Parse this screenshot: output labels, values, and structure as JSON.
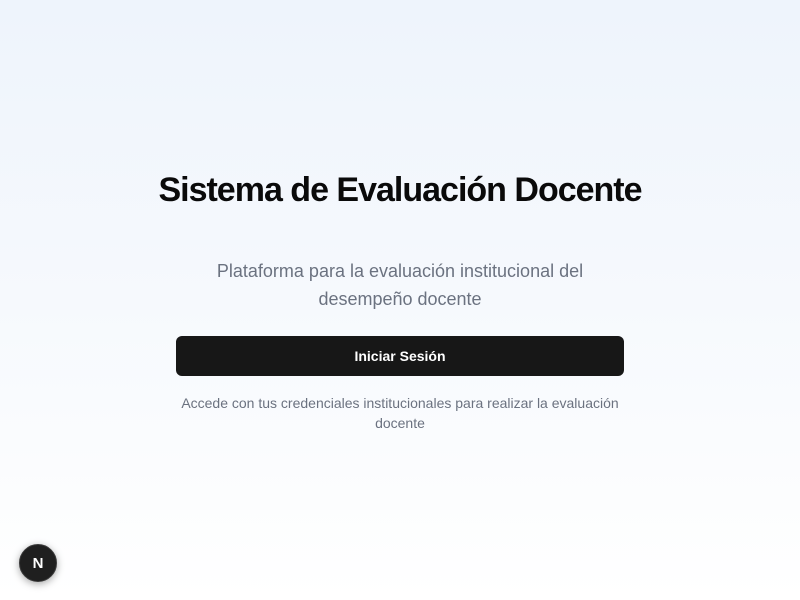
{
  "main": {
    "title": "Sistema de Evaluación Docente",
    "subtitle": "Plataforma para la evaluación institucional del desempeño docente",
    "login_button_label": "Iniciar Sesión",
    "hint": "Accede con tus credenciales institucionales para realizar la evaluación docente"
  },
  "dev_badge": {
    "letter": "N",
    "icon": "nextjs-logo-icon"
  },
  "colors": {
    "button_background": "#171717",
    "title_text": "#0a0a0a",
    "muted_text": "#6b7280",
    "background_top": "#eef4fc",
    "background_bottom": "#ffffff"
  }
}
